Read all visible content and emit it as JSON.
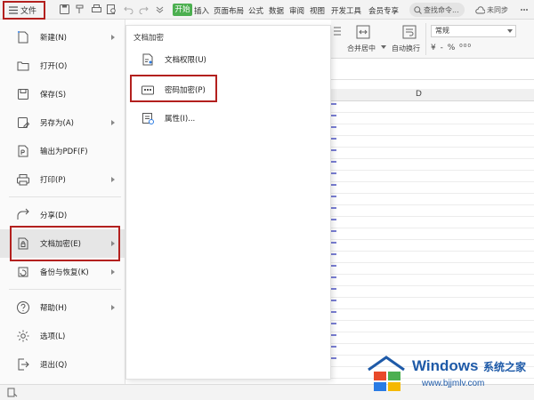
{
  "toolbar": {
    "file_label": "文件",
    "tabs": [
      "开始",
      "插入",
      "页面布局",
      "公式",
      "数据",
      "审阅",
      "视图",
      "开发工具",
      "会员专享"
    ],
    "search_placeholder": "查找命令...",
    "sync_label": "未同步"
  },
  "ribbon": {
    "merge_label": "合并居中",
    "wrap_label": "自动换行",
    "number_format": "常规",
    "number_symbols": "¥ - % ⁰⁰⁰",
    "column_header": "D"
  },
  "file_menu": {
    "items": [
      {
        "label": "新建(N)",
        "icon": "new-file-icon",
        "has_arrow": true
      },
      {
        "label": "打开(O)",
        "icon": "folder-open-icon",
        "has_arrow": false
      },
      {
        "label": "保存(S)",
        "icon": "save-icon",
        "has_arrow": false
      },
      {
        "label": "另存为(A)",
        "icon": "save-as-icon",
        "has_arrow": true
      },
      {
        "label": "输出为PDF(F)",
        "icon": "pdf-icon",
        "has_arrow": false
      },
      {
        "label": "打印(P)",
        "icon": "printer-icon",
        "has_arrow": true
      },
      {
        "label": "分享(D)",
        "icon": "share-icon",
        "has_arrow": false
      },
      {
        "label": "文档加密(E)",
        "icon": "document-lock-icon",
        "has_arrow": true
      },
      {
        "label": "备份与恢复(K)",
        "icon": "backup-icon",
        "has_arrow": true
      },
      {
        "label": "帮助(H)",
        "icon": "help-icon",
        "has_arrow": true
      },
      {
        "label": "选项(L)",
        "icon": "gear-icon",
        "has_arrow": false
      },
      {
        "label": "退出(Q)",
        "icon": "exit-icon",
        "has_arrow": false
      }
    ]
  },
  "submenu": {
    "title": "文档加密",
    "items": [
      {
        "label": "文档权限(U)",
        "icon": "document-permission-icon"
      },
      {
        "label": "密码加密(P)",
        "icon": "password-encrypt-icon"
      },
      {
        "label": "属性(I)...",
        "icon": "properties-icon"
      }
    ]
  },
  "watermark": {
    "brand": "Windows",
    "brand_cn": "系统之家",
    "url": "www.bjjmlv.com"
  },
  "colors": {
    "highlight": "#b3201e",
    "start_tab": "#4caf50",
    "watermark": "#1e5aa8"
  }
}
